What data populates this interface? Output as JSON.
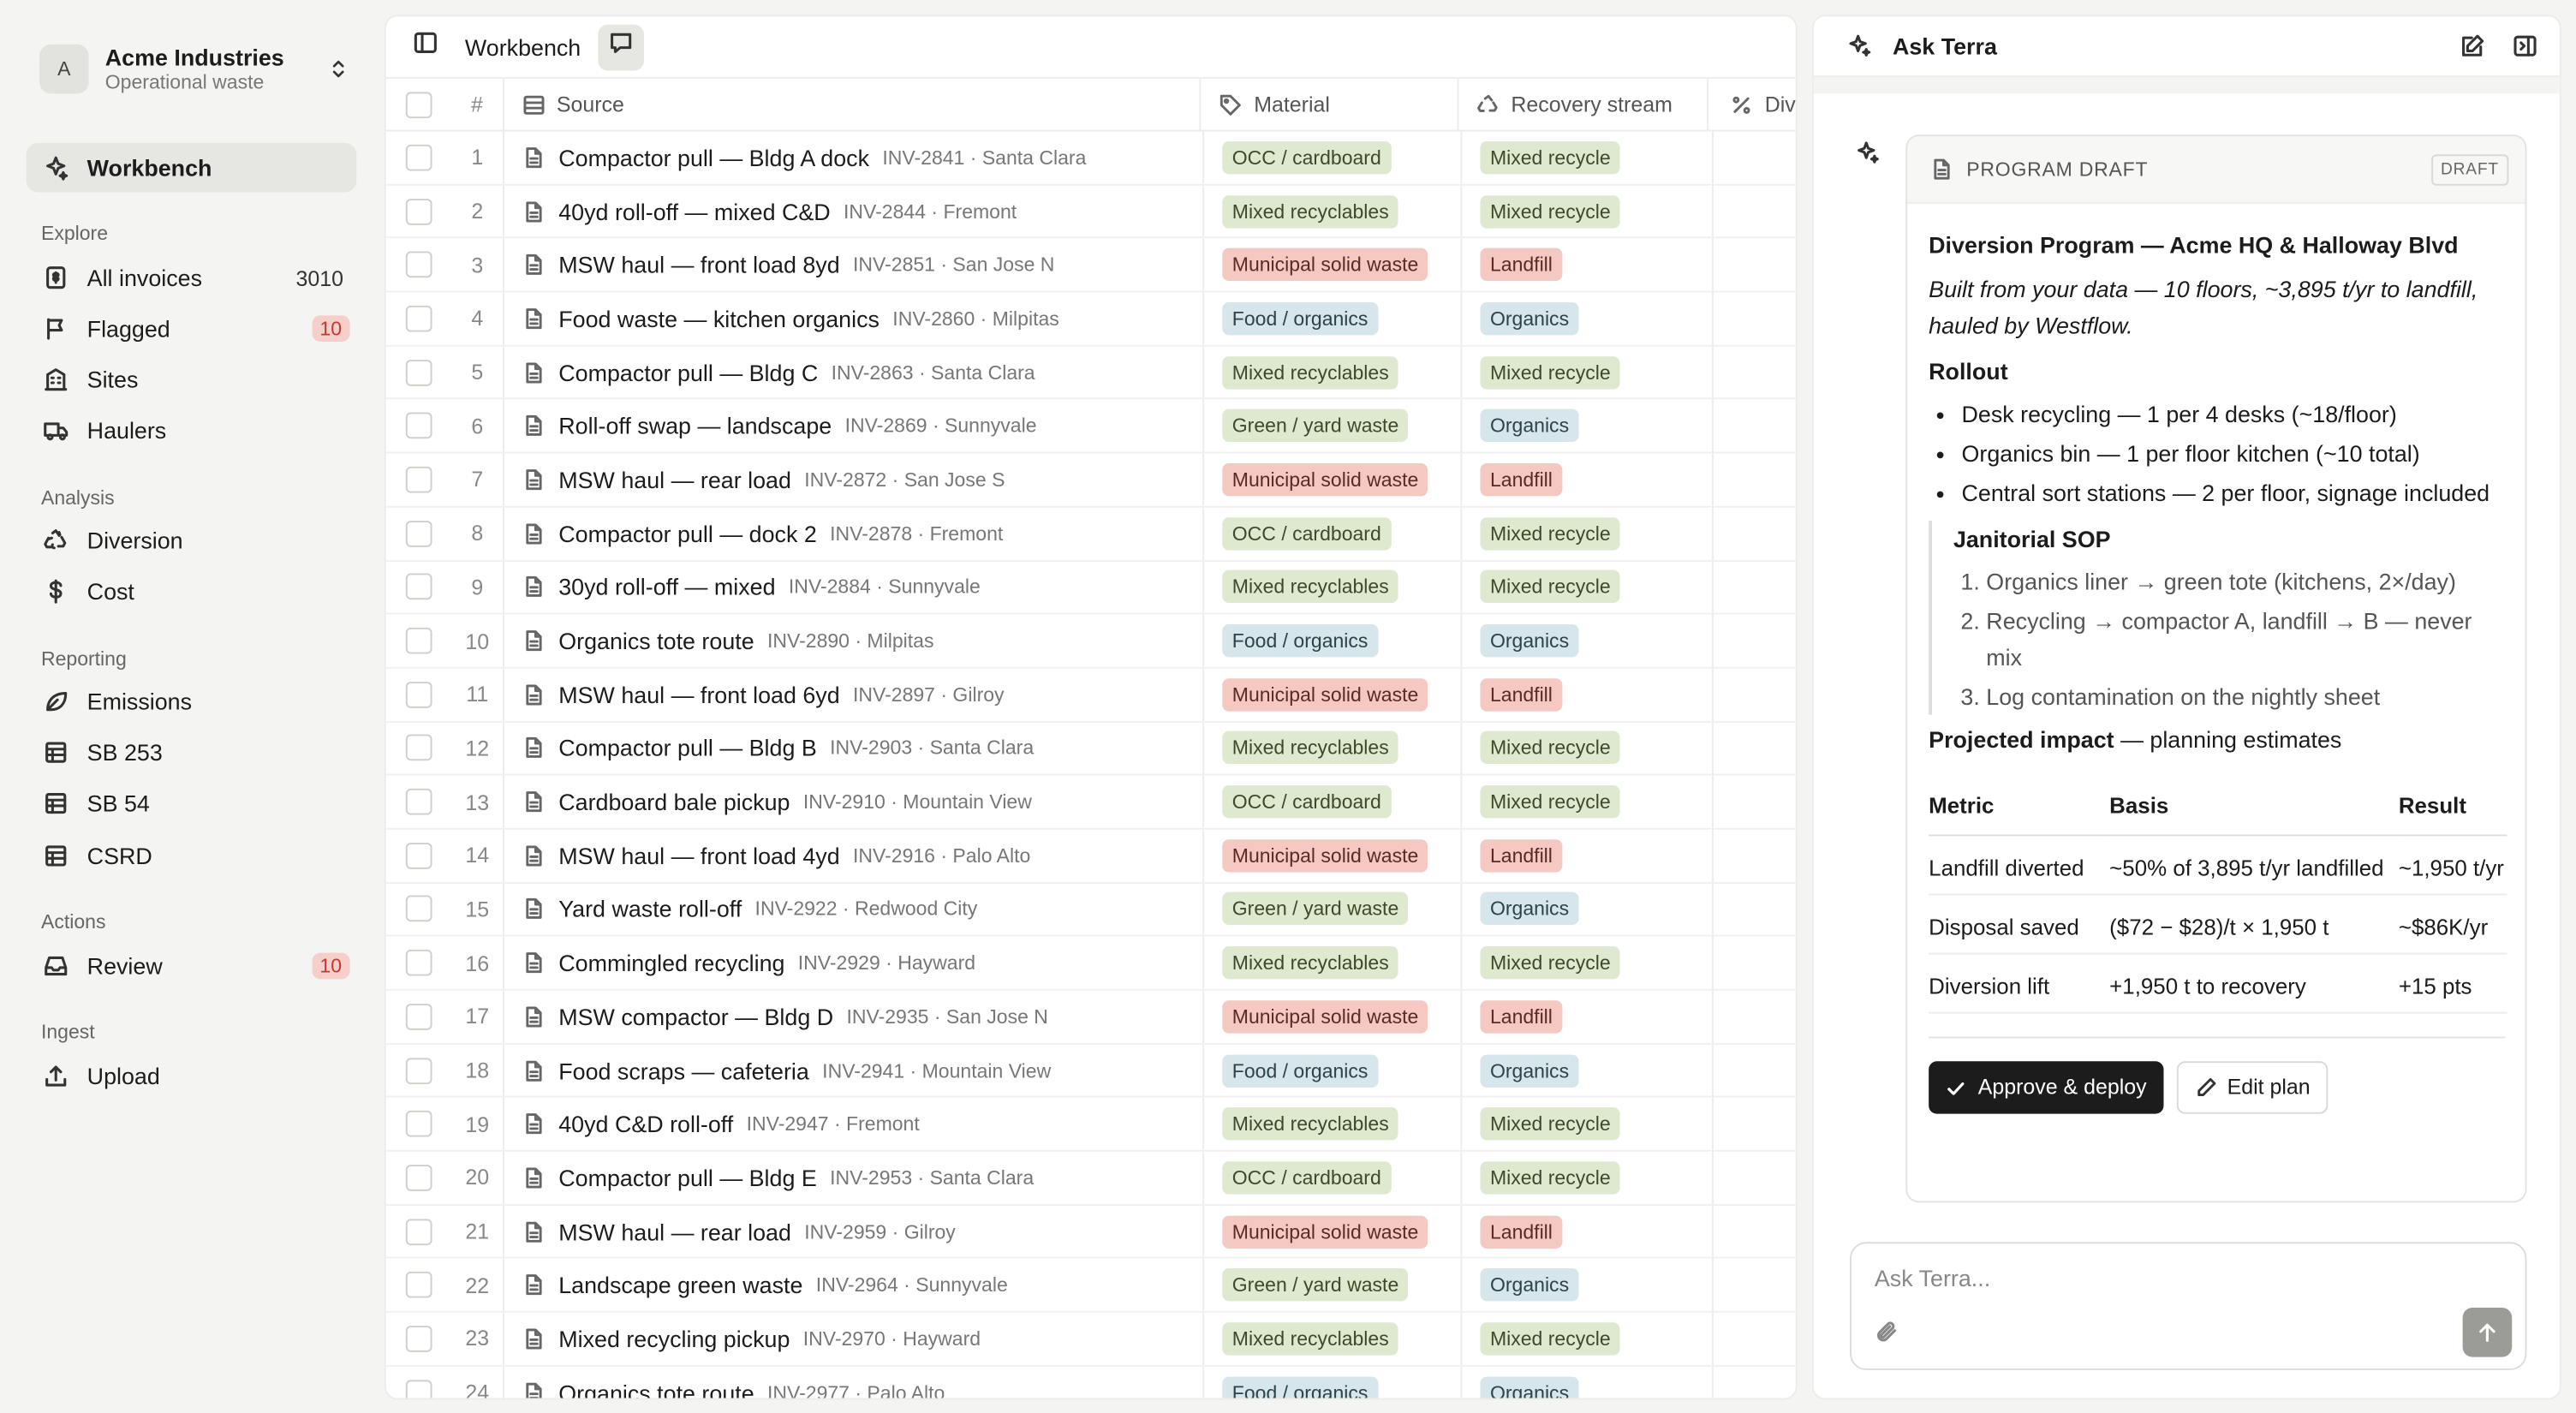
{
  "org": {
    "initial": "A",
    "name": "Acme Industries",
    "subtitle": "Operational waste"
  },
  "sidebar": {
    "workbench": "Workbench",
    "sections": {
      "explore": "Explore",
      "analysis": "Analysis",
      "reporting": "Reporting",
      "actions": "Actions",
      "ingest": "Ingest"
    },
    "all_invoices": {
      "label": "All invoices",
      "count": "3010"
    },
    "flagged": {
      "label": "Flagged",
      "badge": "10"
    },
    "sites": "Sites",
    "haulers": "Haulers",
    "diversion": "Diversion",
    "cost": "Cost",
    "emissions": "Emissions",
    "sb253": "SB 253",
    "sb54": "SB 54",
    "csrd": "CSRD",
    "review": {
      "label": "Review",
      "badge": "10"
    },
    "upload": "Upload"
  },
  "toolbar": {
    "title": "Workbench"
  },
  "table": {
    "headers": {
      "num": "#",
      "source": "Source",
      "material": "Material",
      "recovery": "Recovery stream",
      "div": "Div"
    },
    "rows": [
      {
        "n": "1",
        "title": "Compactor pull — Bldg A dock",
        "meta": "INV-2841 · Santa Clara",
        "material": "OCC / cardboard",
        "recovery": "Mixed recycle"
      },
      {
        "n": "2",
        "title": "40yd roll-off — mixed C&D",
        "meta": "INV-2844 · Fremont",
        "material": "Mixed recyclables",
        "recovery": "Mixed recycle"
      },
      {
        "n": "3",
        "title": "MSW haul — front load 8yd",
        "meta": "INV-2851 · San Jose N",
        "material": "Municipal solid waste",
        "recovery": "Landfill"
      },
      {
        "n": "4",
        "title": "Food waste — kitchen organics",
        "meta": "INV-2860 · Milpitas",
        "material": "Food / organics",
        "recovery": "Organics"
      },
      {
        "n": "5",
        "title": "Compactor pull — Bldg C",
        "meta": "INV-2863 · Santa Clara",
        "material": "Mixed recyclables",
        "recovery": "Mixed recycle"
      },
      {
        "n": "6",
        "title": "Roll-off swap — landscape",
        "meta": "INV-2869 · Sunnyvale",
        "material": "Green / yard waste",
        "recovery": "Organics"
      },
      {
        "n": "7",
        "title": "MSW haul — rear load",
        "meta": "INV-2872 · San Jose S",
        "material": "Municipal solid waste",
        "recovery": "Landfill"
      },
      {
        "n": "8",
        "title": "Compactor pull — dock 2",
        "meta": "INV-2878 · Fremont",
        "material": "OCC / cardboard",
        "recovery": "Mixed recycle"
      },
      {
        "n": "9",
        "title": "30yd roll-off — mixed",
        "meta": "INV-2884 · Sunnyvale",
        "material": "Mixed recyclables",
        "recovery": "Mixed recycle"
      },
      {
        "n": "10",
        "title": "Organics tote route",
        "meta": "INV-2890 · Milpitas",
        "material": "Food / organics",
        "recovery": "Organics"
      },
      {
        "n": "11",
        "title": "MSW haul — front load 6yd",
        "meta": "INV-2897 · Gilroy",
        "material": "Municipal solid waste",
        "recovery": "Landfill"
      },
      {
        "n": "12",
        "title": "Compactor pull — Bldg B",
        "meta": "INV-2903 · Santa Clara",
        "material": "Mixed recyclables",
        "recovery": "Mixed recycle"
      },
      {
        "n": "13",
        "title": "Cardboard bale pickup",
        "meta": "INV-2910 · Mountain View",
        "material": "OCC / cardboard",
        "recovery": "Mixed recycle"
      },
      {
        "n": "14",
        "title": "MSW haul — front load 4yd",
        "meta": "INV-2916 · Palo Alto",
        "material": "Municipal solid waste",
        "recovery": "Landfill"
      },
      {
        "n": "15",
        "title": "Yard waste roll-off",
        "meta": "INV-2922 · Redwood City",
        "material": "Green / yard waste",
        "recovery": "Organics"
      },
      {
        "n": "16",
        "title": "Commingled recycling",
        "meta": "INV-2929 · Hayward",
        "material": "Mixed recyclables",
        "recovery": "Mixed recycle"
      },
      {
        "n": "17",
        "title": "MSW compactor — Bldg D",
        "meta": "INV-2935 · San Jose N",
        "material": "Municipal solid waste",
        "recovery": "Landfill"
      },
      {
        "n": "18",
        "title": "Food scraps — cafeteria",
        "meta": "INV-2941 · Mountain View",
        "material": "Food / organics",
        "recovery": "Organics"
      },
      {
        "n": "19",
        "title": "40yd C&D roll-off",
        "meta": "INV-2947 · Fremont",
        "material": "Mixed recyclables",
        "recovery": "Mixed recycle"
      },
      {
        "n": "20",
        "title": "Compactor pull — Bldg E",
        "meta": "INV-2953 · Santa Clara",
        "material": "OCC / cardboard",
        "recovery": "Mixed recycle"
      },
      {
        "n": "21",
        "title": "MSW haul — rear load",
        "meta": "INV-2959 · Gilroy",
        "material": "Municipal solid waste",
        "recovery": "Landfill"
      },
      {
        "n": "22",
        "title": "Landscape green waste",
        "meta": "INV-2964 · Sunnyvale",
        "material": "Green / yard waste",
        "recovery": "Organics"
      },
      {
        "n": "23",
        "title": "Mixed recycling pickup",
        "meta": "INV-2970 · Hayward",
        "material": "Mixed recyclables",
        "recovery": "Mixed recycle"
      },
      {
        "n": "24",
        "title": "Organics tote route",
        "meta": "INV-2977 · Palo Alto",
        "material": "Food / organics",
        "recovery": "Organics"
      }
    ]
  },
  "chat": {
    "title": "Ask Terra",
    "card": {
      "kicker": "PROGRAM DRAFT",
      "badge": "DRAFT",
      "title": "Diversion Program — Acme HQ & Halloway Blvd",
      "intro": "Built from your data — 10 floors, ~3,895 t/yr to landfill, hauled by Westflow.",
      "rollout_heading": "Rollout",
      "rollout": [
        "Desk recycling — 1 per 4 desks (~18/floor)",
        "Organics bin — 1 per floor kitchen (~10 total)",
        "Central sort stations — 2 per floor, signage included"
      ],
      "sop_heading": "Janitorial SOP",
      "sop": [
        "Organics liner → green tote (kitchens, 2×/day)",
        "Recycling → compactor A, landfill → B — never mix",
        "Log contamination on the nightly sheet"
      ],
      "impact_heading": "Projected impact",
      "impact_note": " — planning estimates",
      "impact_headers": {
        "metric": "Metric",
        "basis": "Basis",
        "result": "Result"
      },
      "impact_rows": [
        {
          "metric": "Landfill diverted",
          "basis": "~50% of 3,895 t/yr landfilled",
          "result": "~1,950 t/yr"
        },
        {
          "metric": "Disposal saved",
          "basis": "($72 − $28)/t × 1,950 t",
          "result": "~$86K/yr"
        },
        {
          "metric": "Diversion lift",
          "basis": "+1,950 t to recovery",
          "result": "+15 pts"
        }
      ],
      "approve_label": "Approve & deploy",
      "edit_label": "Edit plan"
    },
    "composer_placeholder": "Ask Terra..."
  },
  "colors": {
    "pill_green": "#dfe9cf",
    "pill_red": "#f4c9c2",
    "pill_blue": "#d7e6ea",
    "badge_red": "#f6cfcb",
    "primary_button": "#1c1c1c"
  }
}
